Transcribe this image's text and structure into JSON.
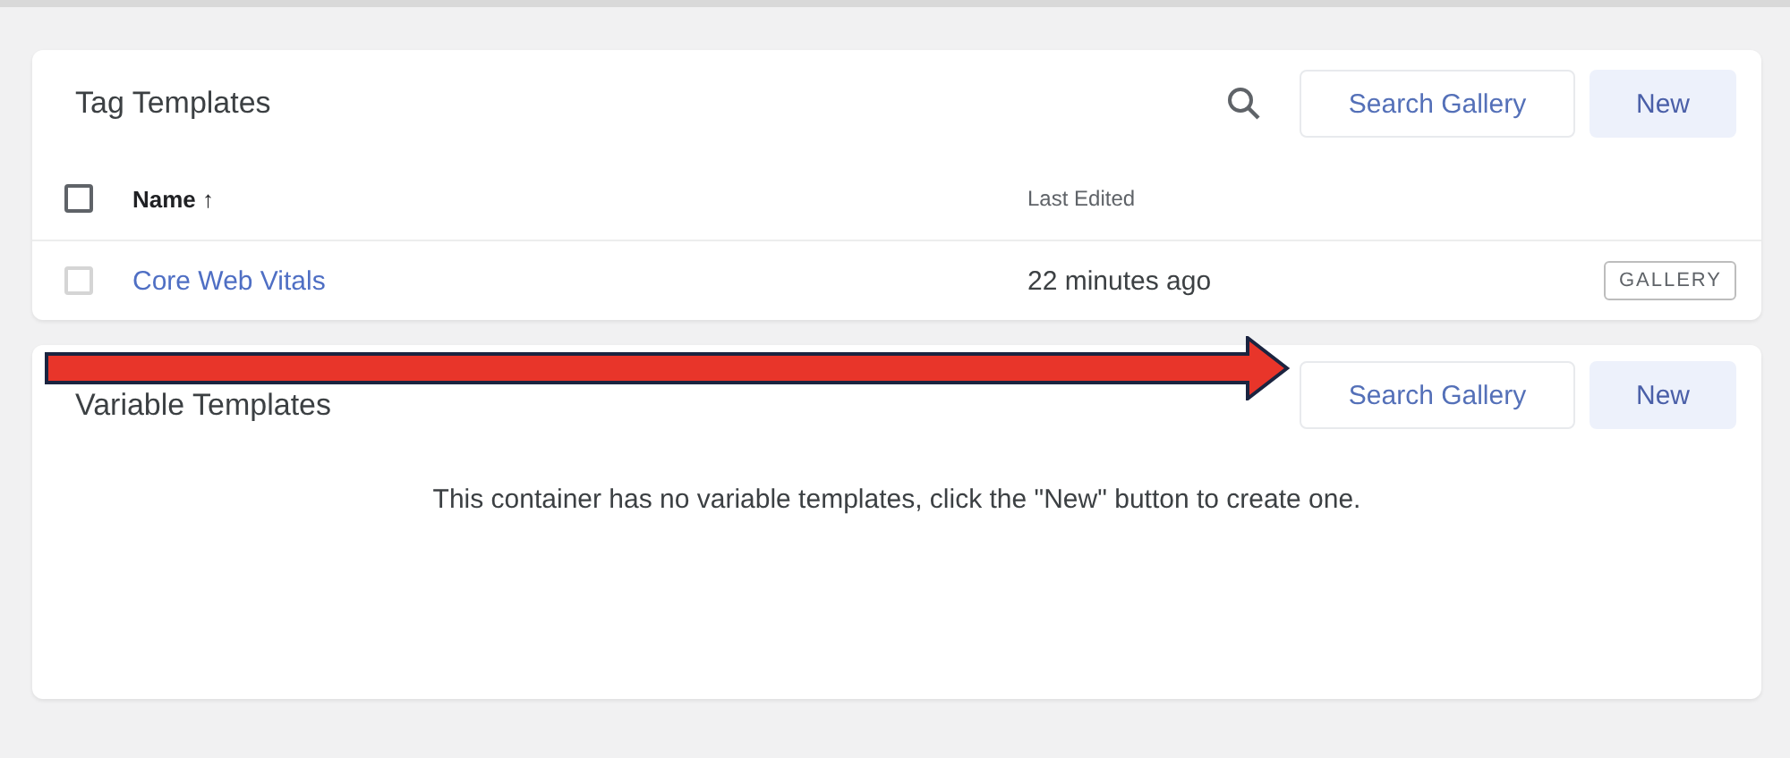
{
  "tag_templates": {
    "title": "Tag Templates",
    "search_gallery": "Search Gallery",
    "new": "New",
    "columns": [
      {
        "label": "Name",
        "sort": "↑"
      },
      {
        "label": "Last Edited"
      }
    ],
    "header_checked": false,
    "rows": [
      {
        "name": "Core Web Vitals",
        "last_edited": "22 minutes ago",
        "badge": "GALLERY",
        "checked": false
      }
    ]
  },
  "variable_templates": {
    "title": "Variable Templates",
    "search_gallery": "Search Gallery",
    "new": "New",
    "empty_message": "This container has no variable templates, click the \"New\" button to create one."
  },
  "annotation": {
    "kind": "arrow",
    "color": "#e8352a"
  }
}
